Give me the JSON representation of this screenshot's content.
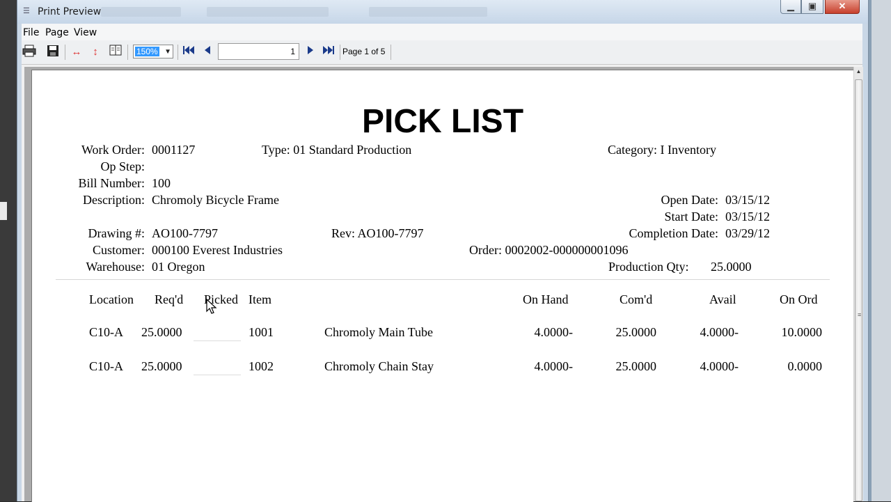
{
  "window": {
    "title": "Print Preview"
  },
  "menu": {
    "file": "File",
    "page": "Page",
    "view": "View"
  },
  "toolbar": {
    "zoom": "150%",
    "page_value": "1",
    "page_of": "Page 1 of 5",
    "icons": [
      "printer-icon",
      "save-icon",
      "fit-width-icon",
      "fit-height-icon",
      "two-page-icon",
      "first-page-icon",
      "prev-page-icon",
      "next-page-icon",
      "last-page-icon"
    ]
  },
  "report": {
    "title": "PICK LIST",
    "fields": {
      "work_order_label": "Work Order:",
      "work_order": "0001127",
      "op_step_label": "Op Step:",
      "bill_number_label": "Bill Number:",
      "bill_number": "100",
      "description_label": "Description:",
      "description": "Chromoly Bicycle Frame",
      "drawing_label": "Drawing #:",
      "drawing": "AO100-7797",
      "customer_label": "Customer:",
      "customer": "000100 Everest Industries",
      "warehouse_label": "Warehouse:",
      "warehouse": "01 Oregon",
      "type": "Type: 01 Standard Production",
      "rev": "Rev: AO100-7797",
      "category": "Category: I Inventory",
      "open_date_label": "Open Date:",
      "open_date": "03/15/12",
      "start_date_label": "Start Date:",
      "start_date": "03/15/12",
      "completion_date_label": "Completion Date:",
      "completion_date": "03/29/12",
      "order": "Order: 0002002-000000001096",
      "production_qty_label": "Production Qty:",
      "production_qty": "25.0000"
    },
    "columns": {
      "location": "Location",
      "reqd": "Req'd",
      "picked": "Picked",
      "item": "Item",
      "on_hand": "On Hand",
      "comd": "Com'd",
      "avail": "Avail",
      "on_ord": "On Ord"
    },
    "rows": [
      {
        "location": "C10-A",
        "reqd": "25.0000",
        "item": "1001",
        "desc": "Chromoly Main Tube",
        "on_hand": "4.0000-",
        "comd": "25.0000",
        "avail": "4.0000-",
        "on_ord": "10.0000"
      },
      {
        "location": "C10-A",
        "reqd": "25.0000",
        "item": "1002",
        "desc": "Chromoly Chain Stay",
        "on_hand": "4.0000-",
        "comd": "25.0000",
        "avail": "4.0000-",
        "on_ord": "0.0000"
      }
    ]
  }
}
